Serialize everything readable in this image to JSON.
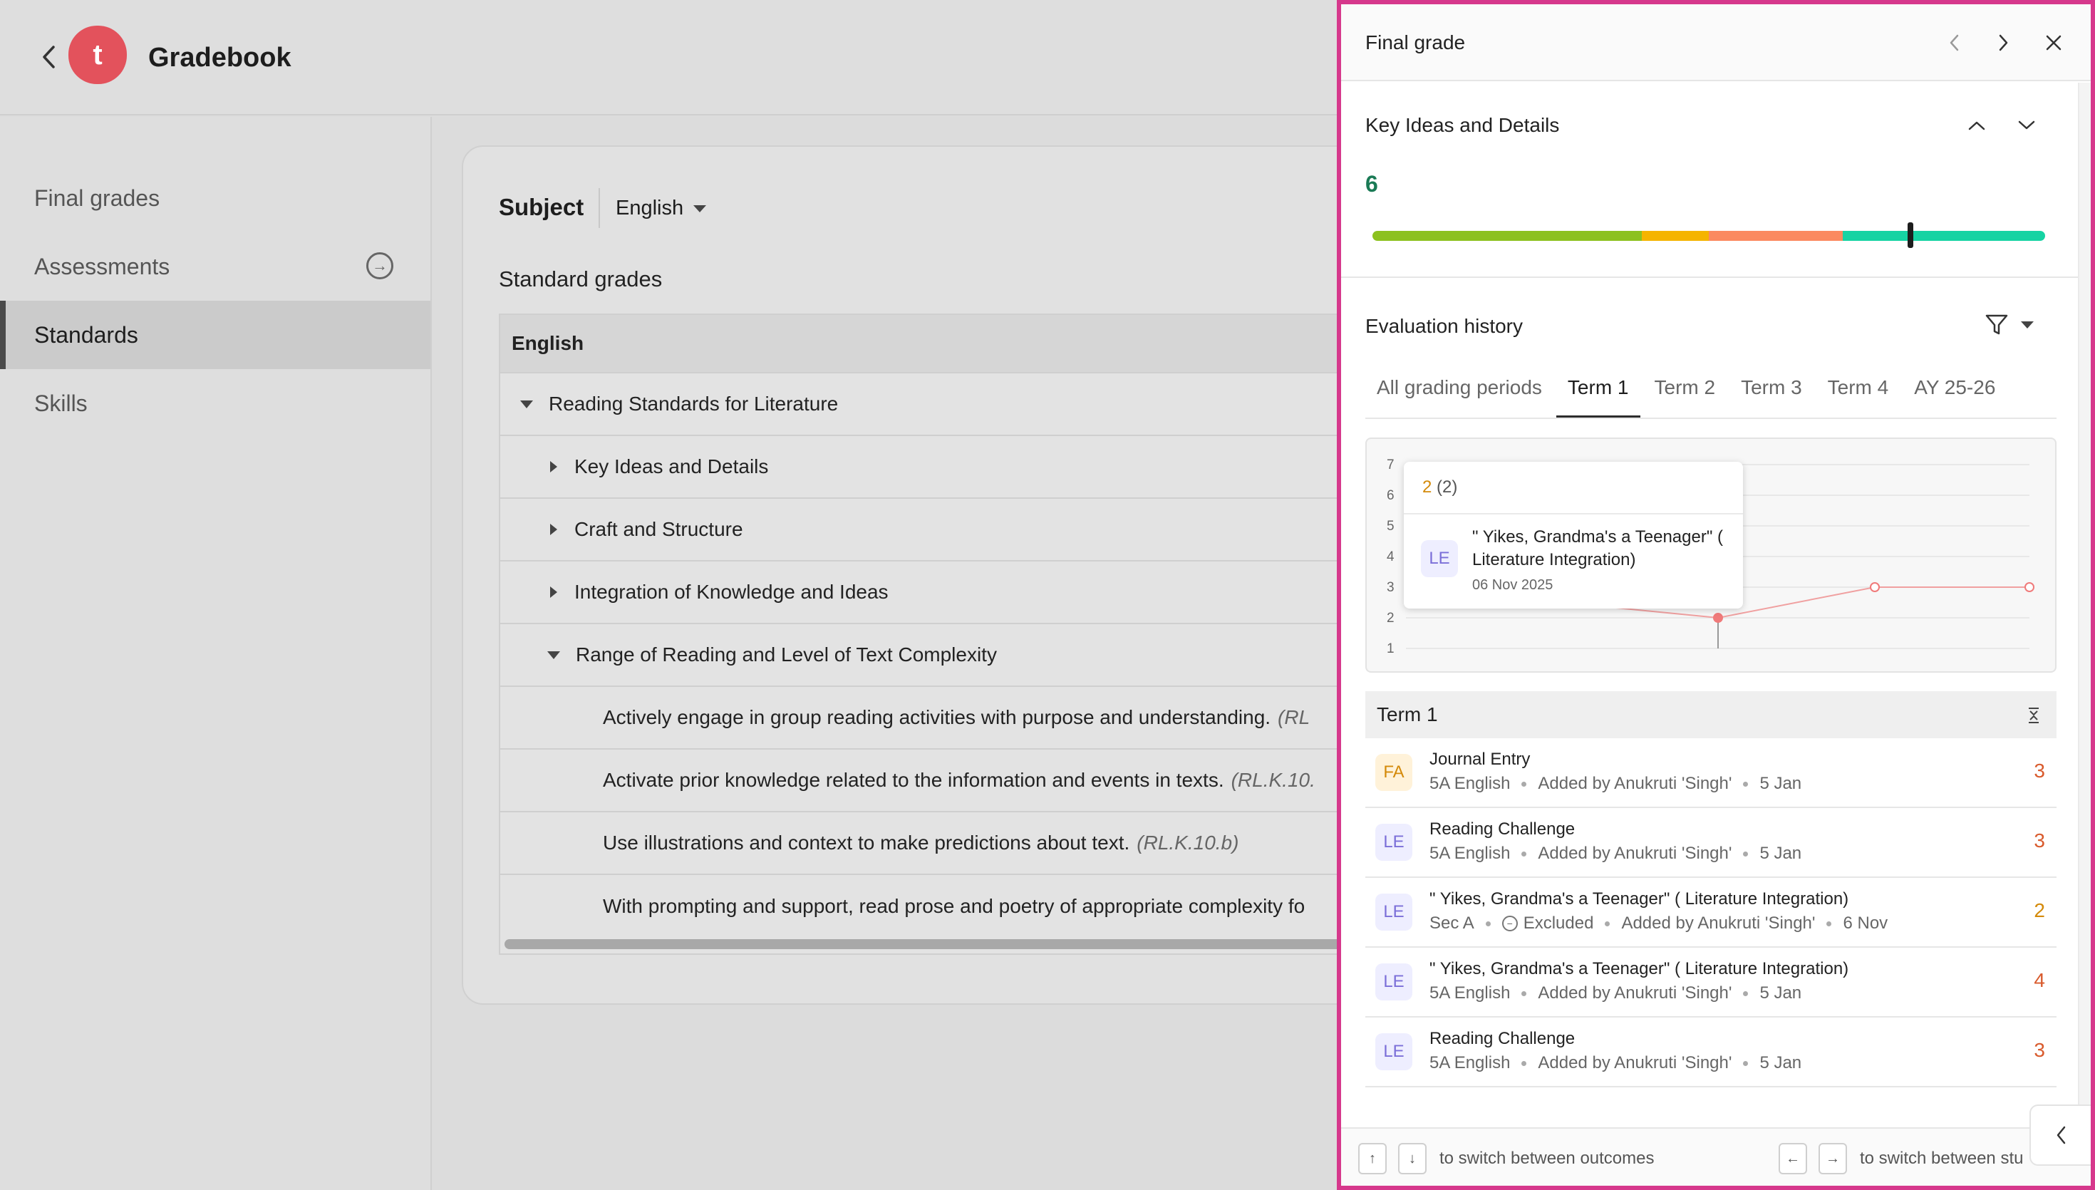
{
  "app": {
    "title": "Gradebook",
    "logo_letter": "t"
  },
  "sidebar": {
    "items": [
      {
        "label": "Final grades"
      },
      {
        "label": "Assessments"
      },
      {
        "label": "Standards"
      },
      {
        "label": "Skills"
      }
    ]
  },
  "main": {
    "subject_label": "Subject",
    "subject_value": "English",
    "section_title": "Standard grades",
    "table": {
      "header": "English",
      "rows": [
        {
          "label": "Reading Standards for Literature"
        },
        {
          "label": "Key Ideas and Details"
        },
        {
          "label": "Craft and Structure"
        },
        {
          "label": "Integration of Knowledge and Ideas"
        },
        {
          "label": "Range of Reading and Level of Text Complexity"
        },
        {
          "label": "Actively engage in group reading activities with purpose and understanding.",
          "ref": "(RL"
        },
        {
          "label": "Activate prior knowledge related to the information and events in texts.",
          "ref": "(RL.K.10."
        },
        {
          "label": "Use illustrations and context to make predictions about text.",
          "ref": "(RL.K.10.b)"
        },
        {
          "label": "With prompting and support, read prose and poetry of appropriate complexity fo",
          "ref": ""
        }
      ]
    }
  },
  "panel": {
    "title": "Final grade",
    "outcome": {
      "title": "Key Ideas and Details",
      "score": "6",
      "bar_fraction": 0.8,
      "colors": {
        "green": "#8cc11f",
        "yellow": "#f5b400",
        "orange": "#fb8a60",
        "teal": "#16d3a3"
      }
    },
    "history": {
      "title": "Evaluation history",
      "tabs": [
        "All grading periods",
        "Term 1",
        "Term 2",
        "Term 3",
        "Term 4",
        "AY 25-26"
      ],
      "active_tab": "Term 1",
      "chart_ticks": [
        "7",
        "6",
        "5",
        "4",
        "3",
        "2",
        "1"
      ],
      "tooltip": {
        "score": "2",
        "count": "(2)",
        "badge": "LE",
        "title": "\" Yikes, Grandma's a Teenager\" ( Literature Integration)",
        "date": "06 Nov 2025"
      }
    },
    "term": {
      "title": "Term 1",
      "rows": [
        {
          "badge": "FA",
          "title": "Journal Entry",
          "meta1": "5A English",
          "meta2": "Added by Anukruti 'Singh'",
          "meta3": "5 Jan",
          "excluded": "",
          "score": "3"
        },
        {
          "badge": "LE",
          "title": "Reading Challenge",
          "meta1": "5A English",
          "meta2": "Added by Anukruti 'Singh'",
          "meta3": "5 Jan",
          "excluded": "",
          "score": "3"
        },
        {
          "badge": "LE",
          "title": "\" Yikes, Grandma's a Teenager\" ( Literature Integration)",
          "meta1": "Sec A",
          "meta2": "Added by Anukruti 'Singh'",
          "meta3": "6 Nov",
          "excluded": "Excluded",
          "score": "2"
        },
        {
          "badge": "LE",
          "title": "\" Yikes, Grandma's a Teenager\" ( Literature Integration)",
          "meta1": "5A English",
          "meta2": "Added by Anukruti 'Singh'",
          "meta3": "5 Jan",
          "excluded": "",
          "score": "4"
        },
        {
          "badge": "LE",
          "title": "Reading Challenge",
          "meta1": "5A English",
          "meta2": "Added by Anukruti 'Singh'",
          "meta3": "5 Jan",
          "excluded": "",
          "score": "3"
        }
      ]
    },
    "footer": {
      "outcomes_hint": "to switch between outcomes",
      "students_hint": "to switch between stu"
    }
  }
}
